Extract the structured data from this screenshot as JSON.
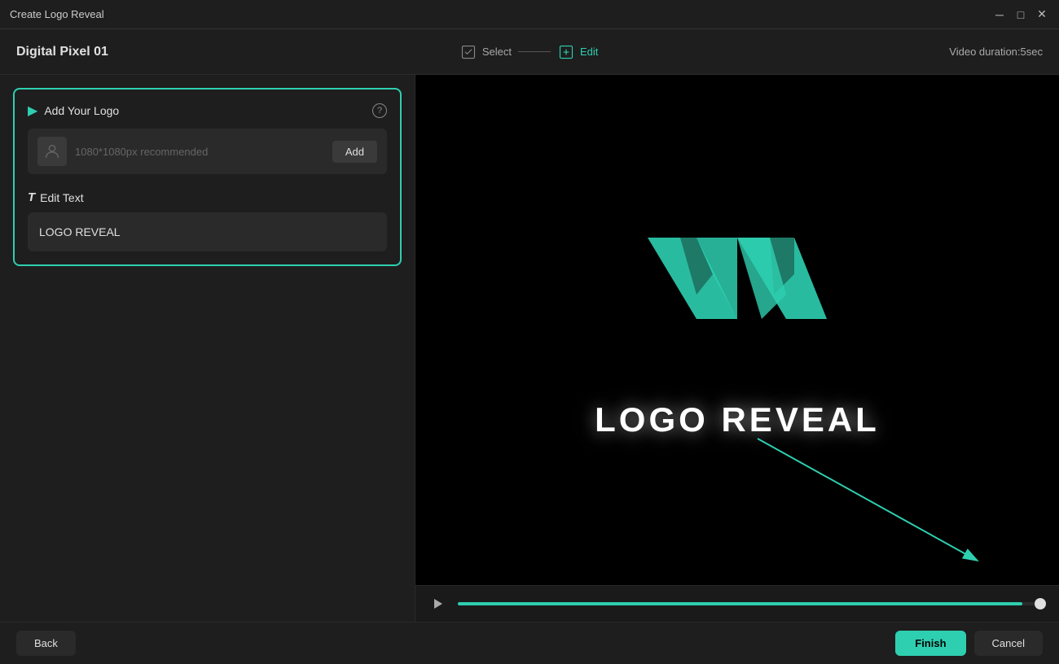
{
  "titlebar": {
    "title": "Create Logo Reveal",
    "min_btn": "─",
    "max_btn": "□",
    "close_btn": "✕"
  },
  "header": {
    "template_name": "Digital Pixel 01",
    "steps": [
      {
        "id": "select",
        "label": "Select",
        "active": false
      },
      {
        "id": "edit",
        "label": "Edit",
        "active": true
      }
    ],
    "duration_label": "Video duration:5sec"
  },
  "left_panel": {
    "add_logo_section": {
      "title": "Add Your Logo",
      "placeholder": "1080*1080px recommended",
      "add_button": "Add",
      "info_icon": "?"
    },
    "edit_text_section": {
      "label": "Edit Text",
      "value": "LOGO REVEAL"
    }
  },
  "right_panel": {
    "preview_text": "LOGO REVEAL",
    "playback": {
      "play_icon": "▷",
      "progress_percent": 96
    }
  },
  "bottom_bar": {
    "back_label": "Back",
    "finish_label": "Finish",
    "cancel_label": "Cancel"
  },
  "colors": {
    "accent": "#2ecfb0",
    "bg_dark": "#1a1a1a",
    "bg_panel": "#1e1e1e",
    "bg_input": "#2a2a2a",
    "text_primary": "#e0e0e0",
    "text_muted": "#aaa"
  }
}
